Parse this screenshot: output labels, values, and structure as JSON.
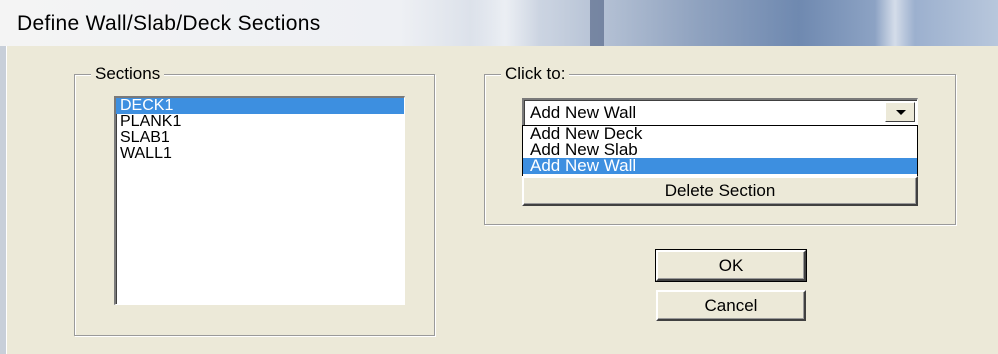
{
  "window": {
    "title": "Define Wall/Slab/Deck Sections"
  },
  "sections": {
    "label": "Sections",
    "items": [
      "DECK1",
      "PLANK1",
      "SLAB1",
      "WALL1"
    ],
    "selected": "DECK1"
  },
  "click_to": {
    "label": "Click to:",
    "combo_value": "Add New Wall",
    "dropdown_options": [
      "Add New Deck",
      "Add New Slab",
      "Add New Wall"
    ],
    "dropdown_selected": "Add New Wall",
    "delete_label": "Delete Section"
  },
  "buttons": {
    "ok_label": "OK",
    "cancel_label": "Cancel"
  },
  "colors": {
    "selection": "#3d8fe0",
    "dialog_bg": "#ece9d8"
  }
}
